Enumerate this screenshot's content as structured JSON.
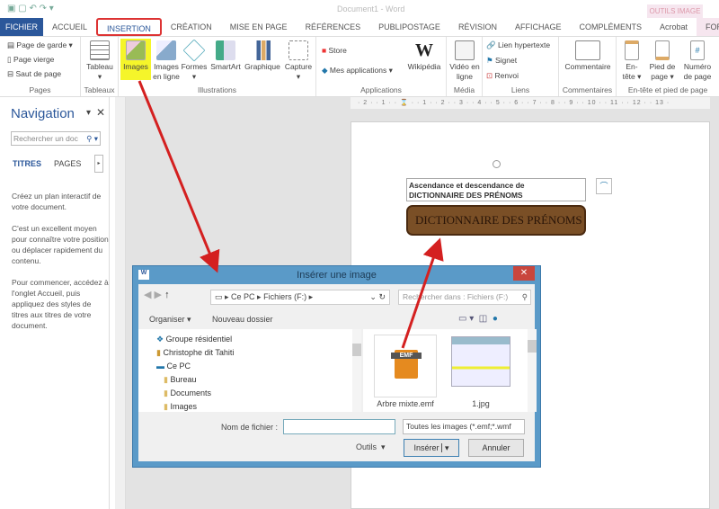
{
  "window": {
    "title": "Document1 - Word",
    "contextual_tab_group": "OUTILS IMAGE"
  },
  "tabs": [
    {
      "label": "FICHIER"
    },
    {
      "label": "ACCUEIL"
    },
    {
      "label": "INSERTION"
    },
    {
      "label": "CRÉATION"
    },
    {
      "label": "MISE EN PAGE"
    },
    {
      "label": "RÉFÉRENCES"
    },
    {
      "label": "PUBLIPOSTAGE"
    },
    {
      "label": "RÉVISION"
    },
    {
      "label": "AFFICHAGE"
    },
    {
      "label": "COMPLÉMENTS"
    },
    {
      "label": "Acrobat"
    },
    {
      "label": "FORMAT"
    }
  ],
  "ribbon": {
    "pages": {
      "label": "Pages",
      "items": [
        "Page de garde",
        "Page vierge",
        "Saut de page"
      ]
    },
    "tableaux": {
      "label": "Tableaux",
      "items": [
        "Tableau"
      ]
    },
    "illustrations": {
      "label": "Illustrations",
      "items": [
        "Images",
        "Images en ligne",
        "Formes",
        "SmartArt",
        "Graphique",
        "Capture"
      ]
    },
    "applications": {
      "label": "Applications",
      "items": [
        "Store",
        "Mes applications",
        "Wikipédia"
      ]
    },
    "media": {
      "label": "Média",
      "items": [
        "Vidéo en ligne"
      ]
    },
    "liens": {
      "label": "Liens",
      "items": [
        "Lien hypertexte",
        "Signet",
        "Renvoi"
      ]
    },
    "commentaires": {
      "label": "Commentaires",
      "items": [
        "Commentaire"
      ]
    },
    "entete": {
      "label": "En-tête et pied de page",
      "items": [
        "En-tête",
        "Pied de page",
        "Numéro de page"
      ]
    },
    "highlight_color": "#f5f52a"
  },
  "navigation": {
    "title": "Navigation",
    "search_placeholder": "Rechercher un doc",
    "tabs": [
      "TITRES",
      "PAGES"
    ],
    "paragraphs": [
      "Créez un plan interactif de votre document.",
      "C'est un excellent moyen pour connaître votre position ou déplacer rapidement du contenu.",
      "Pour commencer, accédez à l'onglet Accueil, puis appliquez des styles de titres aux titres de votre document."
    ]
  },
  "ruler": {
    "ticks": "· 2 · · 1 · · ⌛ · · 1 · · 2 · · 3 · · 4 · · 5 · · 6 · · 7 · · 8 · · 9 · · 10 · · 11 · · 12 · · 13 ·"
  },
  "document": {
    "textbox_line1": "Ascendance et descendance de",
    "textbox_line2": "DICTIONNAIRE DES PRÉNOMS",
    "shape_text": "DICTIONNAIRE DES PRÉNOMS",
    "shape_color": "#7a4f26"
  },
  "dialog": {
    "title": "Insérer une image",
    "breadcrumb": [
      "Ce PC",
      "Fichiers (F:)"
    ],
    "search_placeholder": "Rechercher dans : Fichiers (F:)",
    "organize": "Organiser",
    "new_folder": "Nouveau dossier",
    "tree": [
      "Groupe résidentiel",
      "Christophe dit Tahiti",
      "Ce PC",
      "Bureau",
      "Documents",
      "Images"
    ],
    "files": [
      {
        "name": "Arbre mixte.emf",
        "badge": "EMF"
      },
      {
        "name": "1.jpg"
      }
    ],
    "filename_label": "Nom de fichier :",
    "filename_value": "",
    "filter": "Toutes les images (*.emf;*.wmf",
    "tools": "Outils",
    "insert": "Insérer",
    "cancel": "Annuler"
  },
  "annotation_color": "#d42020"
}
